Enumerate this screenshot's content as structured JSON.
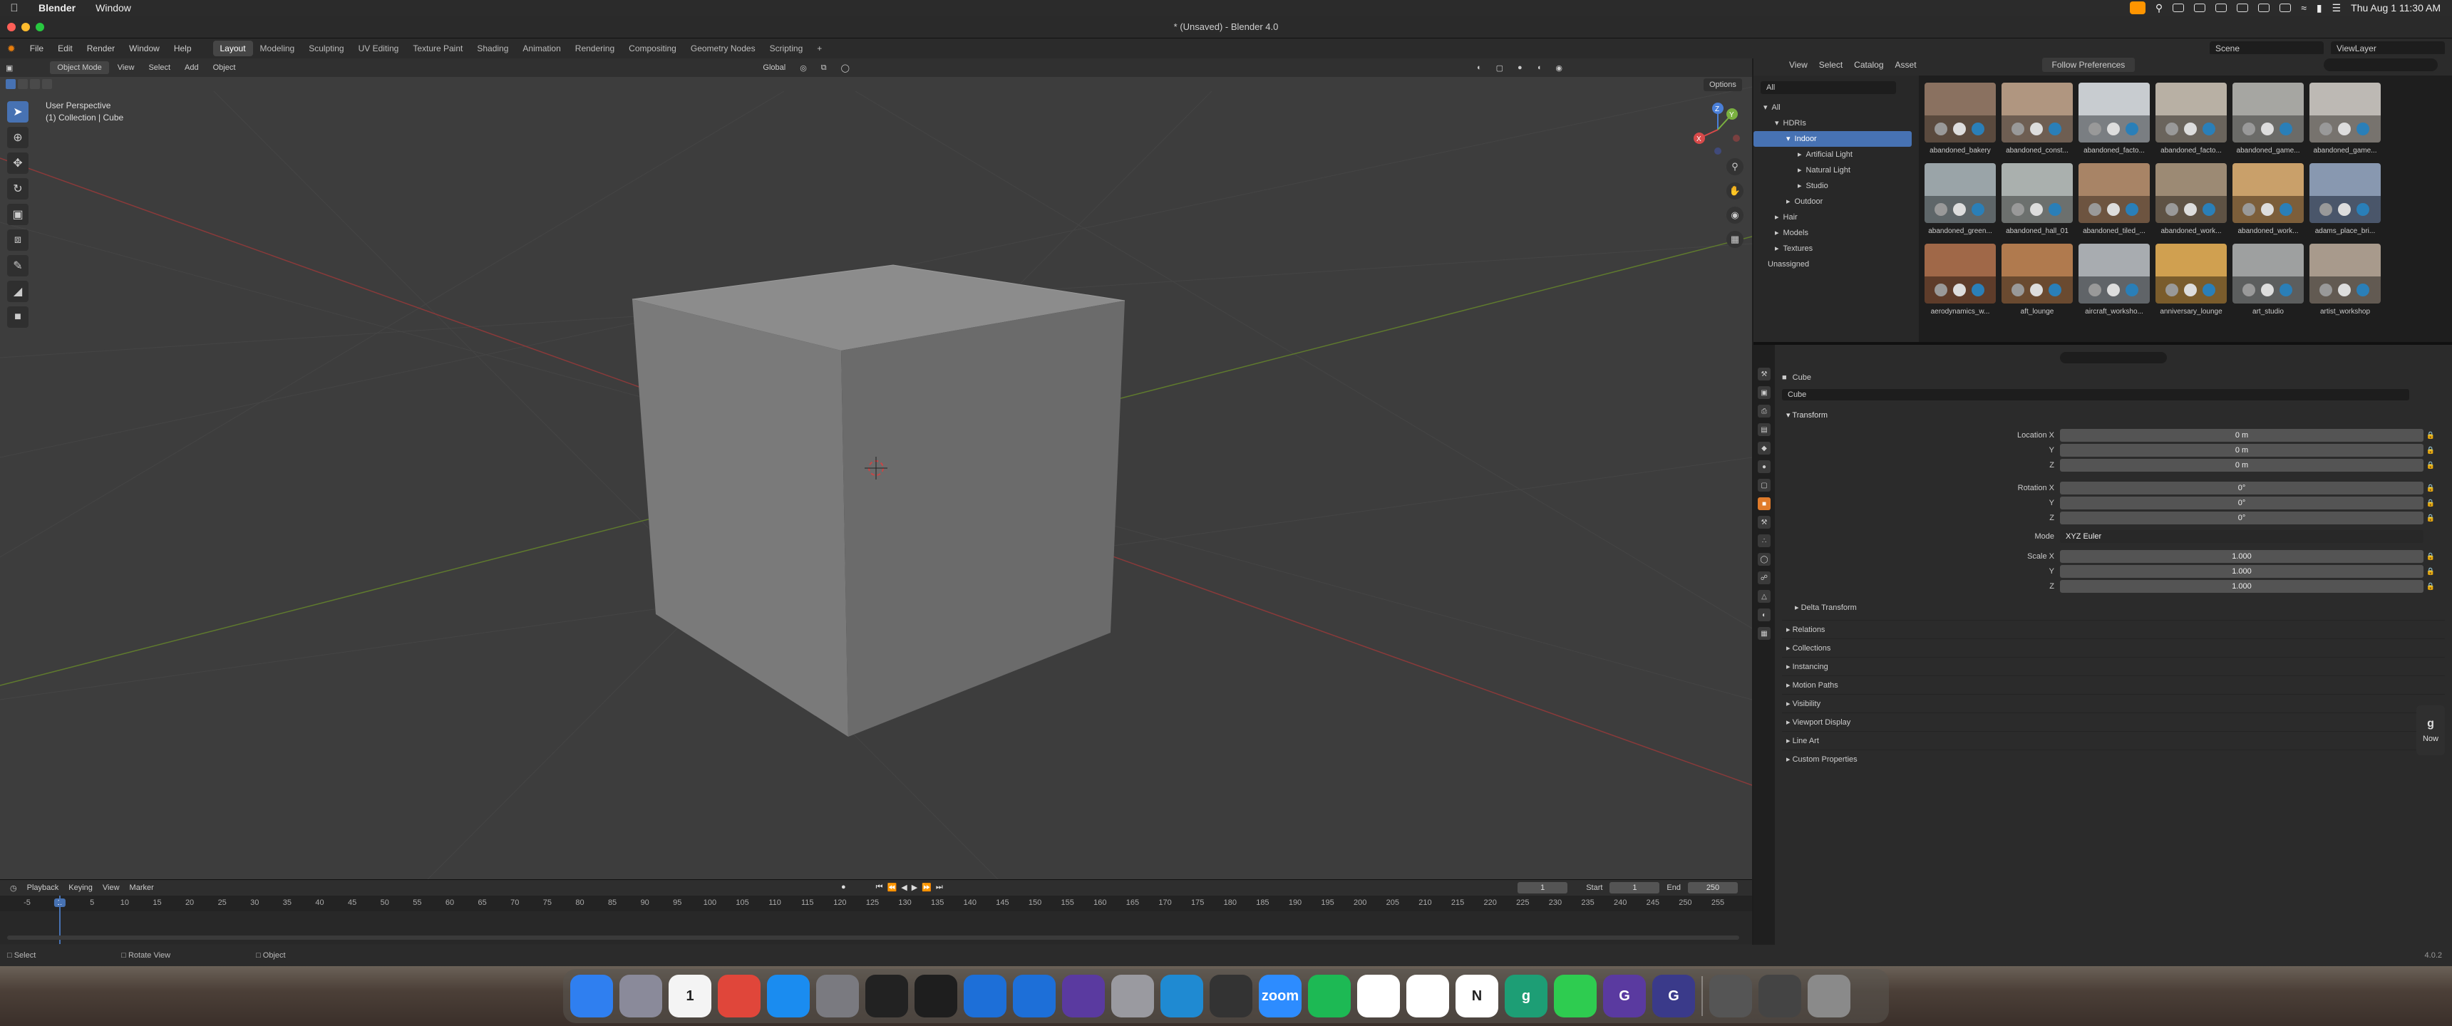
{
  "mac": {
    "app_name": "Blender",
    "menus": [
      "Window"
    ],
    "clock": "Thu Aug 1  11:30 AM"
  },
  "window_title": "* (Unsaved) - Blender 4.0",
  "topbar": {
    "menus": [
      "File",
      "Edit",
      "Render",
      "Window",
      "Help"
    ],
    "workspaces": [
      "Layout",
      "Modeling",
      "Sculpting",
      "UV Editing",
      "Texture Paint",
      "Shading",
      "Animation",
      "Rendering",
      "Compositing",
      "Geometry Nodes",
      "Scripting"
    ],
    "add_tab": "+",
    "scene": "Scene",
    "view_layer": "ViewLayer"
  },
  "viewport": {
    "mode": "Object Mode",
    "menus": [
      "View",
      "Select",
      "Add",
      "Object"
    ],
    "orientation": "Global",
    "options": "Options",
    "info_line1": "User Perspective",
    "info_line2": "(1) Collection | Cube",
    "gizmo": {
      "x": "X",
      "y": "Y",
      "z": "Z"
    }
  },
  "timeline": {
    "menus": [
      "Playback",
      "Keying",
      "View",
      "Marker"
    ],
    "current_frame": "1",
    "start_label": "Start",
    "start": "1",
    "end_label": "End",
    "end": "250",
    "ticks": [
      "-5",
      "1",
      "5",
      "10",
      "15",
      "20",
      "25",
      "30",
      "35",
      "40",
      "45",
      "50",
      "55",
      "60",
      "65",
      "70",
      "75",
      "80",
      "85",
      "90",
      "95",
      "100",
      "105",
      "110",
      "115",
      "120",
      "125",
      "130",
      "135",
      "140",
      "145",
      "150",
      "155",
      "160",
      "165",
      "170",
      "175",
      "180",
      "185",
      "190",
      "195",
      "200",
      "205",
      "210",
      "215",
      "220",
      "225",
      "230",
      "235",
      "240",
      "245",
      "250",
      "255"
    ]
  },
  "statusbar": {
    "select": "Select",
    "rotate": "Rotate View",
    "object": "Object",
    "version": "4.0.2"
  },
  "asset_browser": {
    "menus": [
      "View",
      "Select",
      "Catalog",
      "Asset"
    ],
    "library": "Follow Preferences",
    "filter": "All",
    "tree": [
      {
        "label": "All",
        "depth": 0,
        "arrow": "▾"
      },
      {
        "label": "HDRIs",
        "depth": 1,
        "arrow": "▾"
      },
      {
        "label": "Indoor",
        "depth": 2,
        "arrow": "▾",
        "selected": true
      },
      {
        "label": "Artificial Light",
        "depth": 3,
        "arrow": "▸"
      },
      {
        "label": "Natural Light",
        "depth": 3,
        "arrow": "▸"
      },
      {
        "label": "Studio",
        "depth": 3,
        "arrow": "▸"
      },
      {
        "label": "Outdoor",
        "depth": 2,
        "arrow": "▸"
      },
      {
        "label": "Hair",
        "depth": 1,
        "arrow": "▸"
      },
      {
        "label": "Models",
        "depth": 1,
        "arrow": "▸"
      },
      {
        "label": "Textures",
        "depth": 1,
        "arrow": "▸"
      },
      {
        "label": "Unassigned",
        "depth": 0,
        "arrow": ""
      }
    ],
    "assets": [
      {
        "name": "abandoned_bakery",
        "top": "#8a7160",
        "bot": "#5a4a3e"
      },
      {
        "name": "abandoned_const...",
        "top": "#b09680",
        "bot": "#6e5e52"
      },
      {
        "name": "abandoned_facto...",
        "top": "#c8ccd0",
        "bot": "#7a7e82"
      },
      {
        "name": "abandoned_facto...",
        "top": "#b8b0a4",
        "bot": "#6a645c"
      },
      {
        "name": "abandoned_game...",
        "top": "#a6a6a2",
        "bot": "#6b6b68"
      },
      {
        "name": "abandoned_game...",
        "top": "#bdb9b4",
        "bot": "#77736e"
      },
      {
        "name": "abandoned_green...",
        "top": "#9aa4a8",
        "bot": "#5e6669"
      },
      {
        "name": "abandoned_hall_01",
        "top": "#aab0ae",
        "bot": "#6c706e"
      },
      {
        "name": "abandoned_tiled_...",
        "top": "#a88466",
        "bot": "#6d5440"
      },
      {
        "name": "abandoned_work...",
        "top": "#9c8a74",
        "bot": "#5e5244"
      },
      {
        "name": "abandoned_work...",
        "top": "#c9a06a",
        "bot": "#7c5e3a"
      },
      {
        "name": "adams_place_bri...",
        "top": "#8898b0",
        "bot": "#4a566a"
      },
      {
        "name": "aerodynamics_w...",
        "top": "#a06848",
        "bot": "#5e3c2a"
      },
      {
        "name": "aft_lounge",
        "top": "#b07a4e",
        "bot": "#6a4a30"
      },
      {
        "name": "aircraft_worksho...",
        "top": "#a8acb0",
        "bot": "#606468"
      },
      {
        "name": "anniversary_lounge",
        "top": "#d0a050",
        "bot": "#7a5c2c"
      },
      {
        "name": "art_studio",
        "top": "#9ea0a0",
        "bot": "#5c5e5e"
      },
      {
        "name": "artist_workshop",
        "top": "#a89a8c",
        "bot": "#625a52"
      }
    ]
  },
  "properties": {
    "object_crumb": "Cube",
    "object_name": "Cube",
    "transform_label": "Transform",
    "location": {
      "label": "Location X",
      "x": "0 m",
      "y": "0 m",
      "z": "0 m"
    },
    "rotation": {
      "label": "Rotation X",
      "x": "0°",
      "y": "0°",
      "z": "0°"
    },
    "mode_label": "Mode",
    "mode_value": "XYZ Euler",
    "scale": {
      "label": "Scale X",
      "x": "1.000",
      "y": "1.000",
      "z": "1.000"
    },
    "axis_y": "Y",
    "axis_z": "Z",
    "delta": "Delta Transform",
    "sections": [
      "Relations",
      "Collections",
      "Instancing",
      "Motion Paths",
      "Visibility",
      "Viewport Display",
      "Line Art",
      "Custom Properties"
    ]
  },
  "side_tab": {
    "letter": "g",
    "label": "Now"
  },
  "dock": [
    {
      "name": "finder",
      "label": "",
      "color": "#2f7ff0"
    },
    {
      "name": "launchpad",
      "label": "",
      "color": "#8a8a9a"
    },
    {
      "name": "calendar",
      "label": "1",
      "color": "#f4f4f4"
    },
    {
      "name": "chrome",
      "label": "",
      "color": "#e0463a"
    },
    {
      "name": "app-store",
      "label": "",
      "color": "#1a8cf0"
    },
    {
      "name": "system-settings",
      "label": "",
      "color": "#7a7a80"
    },
    {
      "name": "final-cut",
      "label": "",
      "color": "#222"
    },
    {
      "name": "figma",
      "label": "",
      "color": "#1e1e1e"
    },
    {
      "name": "docs",
      "label": "",
      "color": "#1d6fd8"
    },
    {
      "name": "slides",
      "label": "",
      "color": "#1d6fd8"
    },
    {
      "name": "affinity",
      "label": "",
      "color": "#5a3aa0"
    },
    {
      "name": "dvd",
      "label": "",
      "color": "#9a9aa0"
    },
    {
      "name": "vscode",
      "label": "",
      "color": "#1f8ad2"
    },
    {
      "name": "blender",
      "label": "",
      "color": "#333"
    },
    {
      "name": "zoom",
      "label": "zoom",
      "color": "#2d8cff"
    },
    {
      "name": "spotify",
      "label": "",
      "color": "#1db954"
    },
    {
      "name": "circle-app",
      "label": "",
      "color": "#ffffff"
    },
    {
      "name": "slack",
      "label": "",
      "color": "#ffffff"
    },
    {
      "name": "notion",
      "label": "N",
      "color": "#ffffff"
    },
    {
      "name": "grammarly",
      "label": "g",
      "color": "#1d9e75"
    },
    {
      "name": "messages",
      "label": "",
      "color": "#2ecc50"
    },
    {
      "name": "grammarly-alt",
      "label": "G",
      "color": "#5a3aa0"
    },
    {
      "name": "grammarly-2",
      "label": "G",
      "color": "#3a3a8a"
    },
    {
      "name": "downloads-stack",
      "label": "",
      "color": "#555"
    },
    {
      "name": "screens-stack",
      "label": "",
      "color": "#444"
    },
    {
      "name": "trash",
      "label": "",
      "color": "#8a8a8a"
    }
  ]
}
